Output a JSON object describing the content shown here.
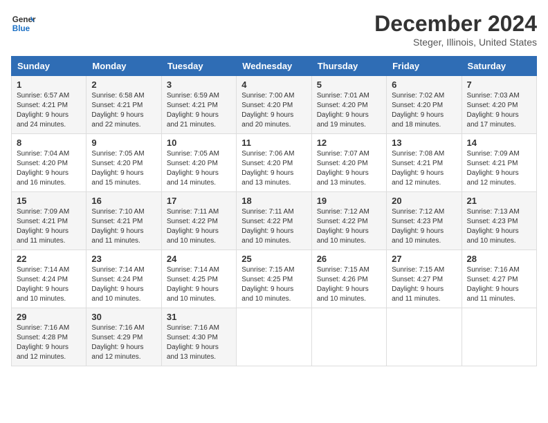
{
  "header": {
    "logo_line1": "General",
    "logo_line2": "Blue",
    "month_year": "December 2024",
    "location": "Steger, Illinois, United States"
  },
  "weekdays": [
    "Sunday",
    "Monday",
    "Tuesday",
    "Wednesday",
    "Thursday",
    "Friday",
    "Saturday"
  ],
  "weeks": [
    [
      {
        "day": "1",
        "sunrise": "6:57 AM",
        "sunset": "4:21 PM",
        "daylight": "9 hours and 24 minutes."
      },
      {
        "day": "2",
        "sunrise": "6:58 AM",
        "sunset": "4:21 PM",
        "daylight": "9 hours and 22 minutes."
      },
      {
        "day": "3",
        "sunrise": "6:59 AM",
        "sunset": "4:21 PM",
        "daylight": "9 hours and 21 minutes."
      },
      {
        "day": "4",
        "sunrise": "7:00 AM",
        "sunset": "4:20 PM",
        "daylight": "9 hours and 20 minutes."
      },
      {
        "day": "5",
        "sunrise": "7:01 AM",
        "sunset": "4:20 PM",
        "daylight": "9 hours and 19 minutes."
      },
      {
        "day": "6",
        "sunrise": "7:02 AM",
        "sunset": "4:20 PM",
        "daylight": "9 hours and 18 minutes."
      },
      {
        "day": "7",
        "sunrise": "7:03 AM",
        "sunset": "4:20 PM",
        "daylight": "9 hours and 17 minutes."
      }
    ],
    [
      {
        "day": "8",
        "sunrise": "7:04 AM",
        "sunset": "4:20 PM",
        "daylight": "9 hours and 16 minutes."
      },
      {
        "day": "9",
        "sunrise": "7:05 AM",
        "sunset": "4:20 PM",
        "daylight": "9 hours and 15 minutes."
      },
      {
        "day": "10",
        "sunrise": "7:05 AM",
        "sunset": "4:20 PM",
        "daylight": "9 hours and 14 minutes."
      },
      {
        "day": "11",
        "sunrise": "7:06 AM",
        "sunset": "4:20 PM",
        "daylight": "9 hours and 13 minutes."
      },
      {
        "day": "12",
        "sunrise": "7:07 AM",
        "sunset": "4:20 PM",
        "daylight": "9 hours and 13 minutes."
      },
      {
        "day": "13",
        "sunrise": "7:08 AM",
        "sunset": "4:21 PM",
        "daylight": "9 hours and 12 minutes."
      },
      {
        "day": "14",
        "sunrise": "7:09 AM",
        "sunset": "4:21 PM",
        "daylight": "9 hours and 12 minutes."
      }
    ],
    [
      {
        "day": "15",
        "sunrise": "7:09 AM",
        "sunset": "4:21 PM",
        "daylight": "9 hours and 11 minutes."
      },
      {
        "day": "16",
        "sunrise": "7:10 AM",
        "sunset": "4:21 PM",
        "daylight": "9 hours and 11 minutes."
      },
      {
        "day": "17",
        "sunrise": "7:11 AM",
        "sunset": "4:22 PM",
        "daylight": "9 hours and 10 minutes."
      },
      {
        "day": "18",
        "sunrise": "7:11 AM",
        "sunset": "4:22 PM",
        "daylight": "9 hours and 10 minutes."
      },
      {
        "day": "19",
        "sunrise": "7:12 AM",
        "sunset": "4:22 PM",
        "daylight": "9 hours and 10 minutes."
      },
      {
        "day": "20",
        "sunrise": "7:12 AM",
        "sunset": "4:23 PM",
        "daylight": "9 hours and 10 minutes."
      },
      {
        "day": "21",
        "sunrise": "7:13 AM",
        "sunset": "4:23 PM",
        "daylight": "9 hours and 10 minutes."
      }
    ],
    [
      {
        "day": "22",
        "sunrise": "7:14 AM",
        "sunset": "4:24 PM",
        "daylight": "9 hours and 10 minutes."
      },
      {
        "day": "23",
        "sunrise": "7:14 AM",
        "sunset": "4:24 PM",
        "daylight": "9 hours and 10 minutes."
      },
      {
        "day": "24",
        "sunrise": "7:14 AM",
        "sunset": "4:25 PM",
        "daylight": "9 hours and 10 minutes."
      },
      {
        "day": "25",
        "sunrise": "7:15 AM",
        "sunset": "4:25 PM",
        "daylight": "9 hours and 10 minutes."
      },
      {
        "day": "26",
        "sunrise": "7:15 AM",
        "sunset": "4:26 PM",
        "daylight": "9 hours and 10 minutes."
      },
      {
        "day": "27",
        "sunrise": "7:15 AM",
        "sunset": "4:27 PM",
        "daylight": "9 hours and 11 minutes."
      },
      {
        "day": "28",
        "sunrise": "7:16 AM",
        "sunset": "4:27 PM",
        "daylight": "9 hours and 11 minutes."
      }
    ],
    [
      {
        "day": "29",
        "sunrise": "7:16 AM",
        "sunset": "4:28 PM",
        "daylight": "9 hours and 12 minutes."
      },
      {
        "day": "30",
        "sunrise": "7:16 AM",
        "sunset": "4:29 PM",
        "daylight": "9 hours and 12 minutes."
      },
      {
        "day": "31",
        "sunrise": "7:16 AM",
        "sunset": "4:30 PM",
        "daylight": "9 hours and 13 minutes."
      },
      null,
      null,
      null,
      null
    ]
  ]
}
